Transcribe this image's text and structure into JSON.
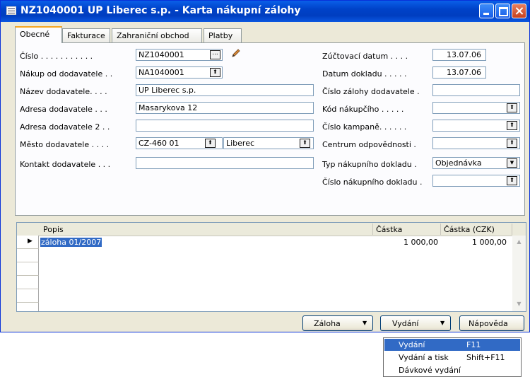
{
  "window": {
    "title": "NZ1040001 UP Liberec s.p. - Karta nákupní zálohy"
  },
  "tabs": [
    "Obecné",
    "Fakturace",
    "Zahraniční obchod",
    "Platby"
  ],
  "left_fields": {
    "cislo": {
      "label": "Číslo . . . . . . . . . . .",
      "value": "NZ1040001"
    },
    "nakup_od": {
      "label": "Nákup od dodavatele . .",
      "value": "NA1040001"
    },
    "nazev": {
      "label": "Název dodavatele. . . .",
      "value": "UP Liberec s.p."
    },
    "adresa": {
      "label": "Adresa dodavatele . . .",
      "value": "Masarykova 12"
    },
    "adresa2": {
      "label": "Adresa dodavatele 2 . .",
      "value": ""
    },
    "mesto": {
      "label": "Město dodavatele . . . .",
      "psc": "CZ-460 01",
      "city": "Liberec"
    },
    "kontakt": {
      "label": "Kontakt dodavatele . . .",
      "value": ""
    }
  },
  "right_fields": {
    "zuctovaci": {
      "label": "Zúčtovací datum . . . .",
      "value": "13.07.06"
    },
    "datum_dokladu": {
      "label": "Datum dokladu . . . . .",
      "value": "13.07.06"
    },
    "cislo_zalohy": {
      "label": "Číslo zálohy dodavatele .",
      "value": ""
    },
    "kod_nakupciho": {
      "label": "Kód nákupčího . . . . .",
      "value": ""
    },
    "cislo_kampane": {
      "label": "Číslo kampaně. . . . . .",
      "value": ""
    },
    "centrum": {
      "label": "Centrum odpovědnosti .",
      "value": ""
    },
    "typ_dokladu": {
      "label": "Typ nákupního dokladu .",
      "value": "Objednávka"
    },
    "cislo_dokladu": {
      "label": "Číslo nákupního dokladu .",
      "value": ""
    }
  },
  "lines": {
    "columns": [
      "Popis",
      "Částka",
      "Částka (CZK)"
    ],
    "rows": [
      {
        "popis": "záloha 01/2007",
        "castka": "1 000,00",
        "castka_czk": "1 000,00"
      }
    ]
  },
  "buttons": {
    "zaloha": "Záloha",
    "vydani": "Vydání",
    "napoveda": "Nápověda"
  },
  "menu": {
    "items": [
      {
        "label": "Vydání",
        "shortcut": "F11"
      },
      {
        "label": "Vydání a tisk",
        "shortcut": "Shift+F11"
      },
      {
        "label": "Dávkové vydání",
        "shortcut": ""
      }
    ]
  }
}
